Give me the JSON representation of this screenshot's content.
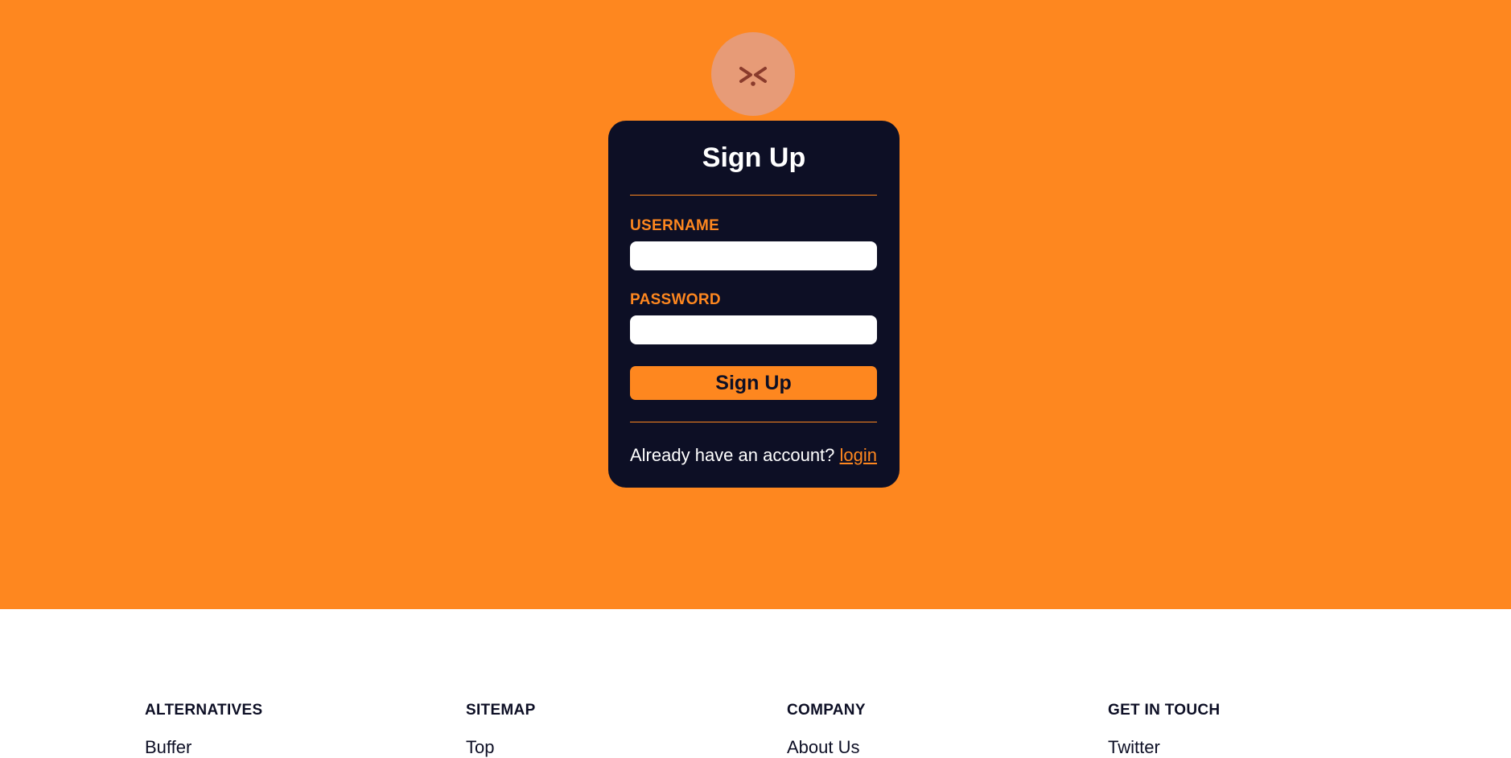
{
  "colors": {
    "accent": "#fe871f",
    "card_bg": "#0d0f25",
    "avatar_bg": "#e79b77",
    "avatar_face": "#8a3b2c"
  },
  "avatar": {
    "icon": "squinting-face-icon"
  },
  "signup_card": {
    "title": "Sign Up",
    "username_label": "USERNAME",
    "username_value": "",
    "password_label": "PASSWORD",
    "password_value": "",
    "submit_label": "Sign Up",
    "login_prompt": "Already have an account?",
    "login_link": "login"
  },
  "footer": {
    "columns": [
      {
        "heading": "ALTERNATIVES",
        "links": [
          "Buffer"
        ]
      },
      {
        "heading": "SITEMAP",
        "links": [
          "Top"
        ]
      },
      {
        "heading": "COMPANY",
        "links": [
          "About Us"
        ]
      },
      {
        "heading": "GET IN TOUCH",
        "links": [
          "Twitter"
        ]
      }
    ]
  }
}
